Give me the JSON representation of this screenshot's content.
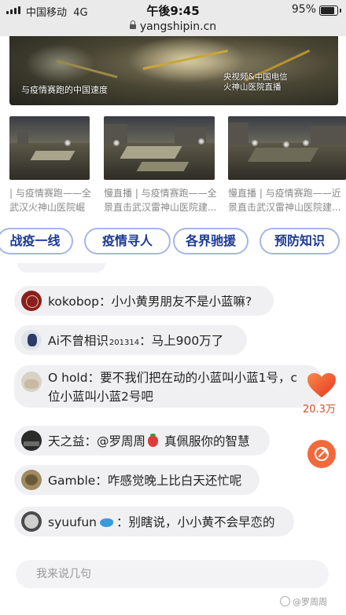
{
  "status_bar": {
    "carrier": "中国移动",
    "network": "4G",
    "time": "午後9:45",
    "battery": "95%"
  },
  "browser": {
    "url": "yangshipin.cn"
  },
  "banner": {
    "caption_left": "与疫情赛跑的中国速度",
    "caption_right_line1": "央视频&中国电信",
    "caption_right_line2": "火神山医院直播"
  },
  "videos": [
    {
      "caption_line1": "| 与疫情赛跑——全",
      "caption_line2": "武汉火神山医院崛"
    },
    {
      "caption_line1": "慢直播 | 与疫情赛跑——全",
      "caption_line2": "景直击武汉雷神山医院建..."
    },
    {
      "caption_line1": "慢直播 | 与疫情赛跑——近",
      "caption_line2": "景直击武汉雷神山医院建..."
    }
  ],
  "tabs": [
    "战疫一线",
    "疫情寻人",
    "各界驰援",
    "预防知识"
  ],
  "comments": [
    {
      "user": "kokobop",
      "text": "小小黄男朋友不是小蓝嘛?"
    },
    {
      "user": "Ai不曾相识",
      "user_suffix": "201314",
      "text": "马上900万了"
    },
    {
      "user": "O hold",
      "text": "要不我们把在动的小蓝叫小蓝1号，c",
      "text_line2": "位小蓝叫小蓝2号吧"
    },
    {
      "user": "天之益",
      "text": "@罗周周",
      "text_after_emoji": "真佩服你的智慧"
    },
    {
      "user": "Gamble",
      "text": "咋感觉晚上比白天还忙呢"
    },
    {
      "user": "syuufun",
      "text": "别瞎说，小小黄不会早恋的"
    }
  ],
  "likes": {
    "count": "20.3万"
  },
  "input": {
    "placeholder": "我来说几句"
  },
  "watermark": "@罗周周",
  "colors": {
    "tab_text": "#1d3a94",
    "tab_border": "#a5b5ea",
    "like": "#e24b23",
    "share": "#f06a3c"
  },
  "icons": [
    "signal-icon",
    "lock-icon",
    "battery-icon",
    "heart-icon",
    "share-icon",
    "strawberry-emoji",
    "whale-emoji",
    "weibo-icon"
  ]
}
